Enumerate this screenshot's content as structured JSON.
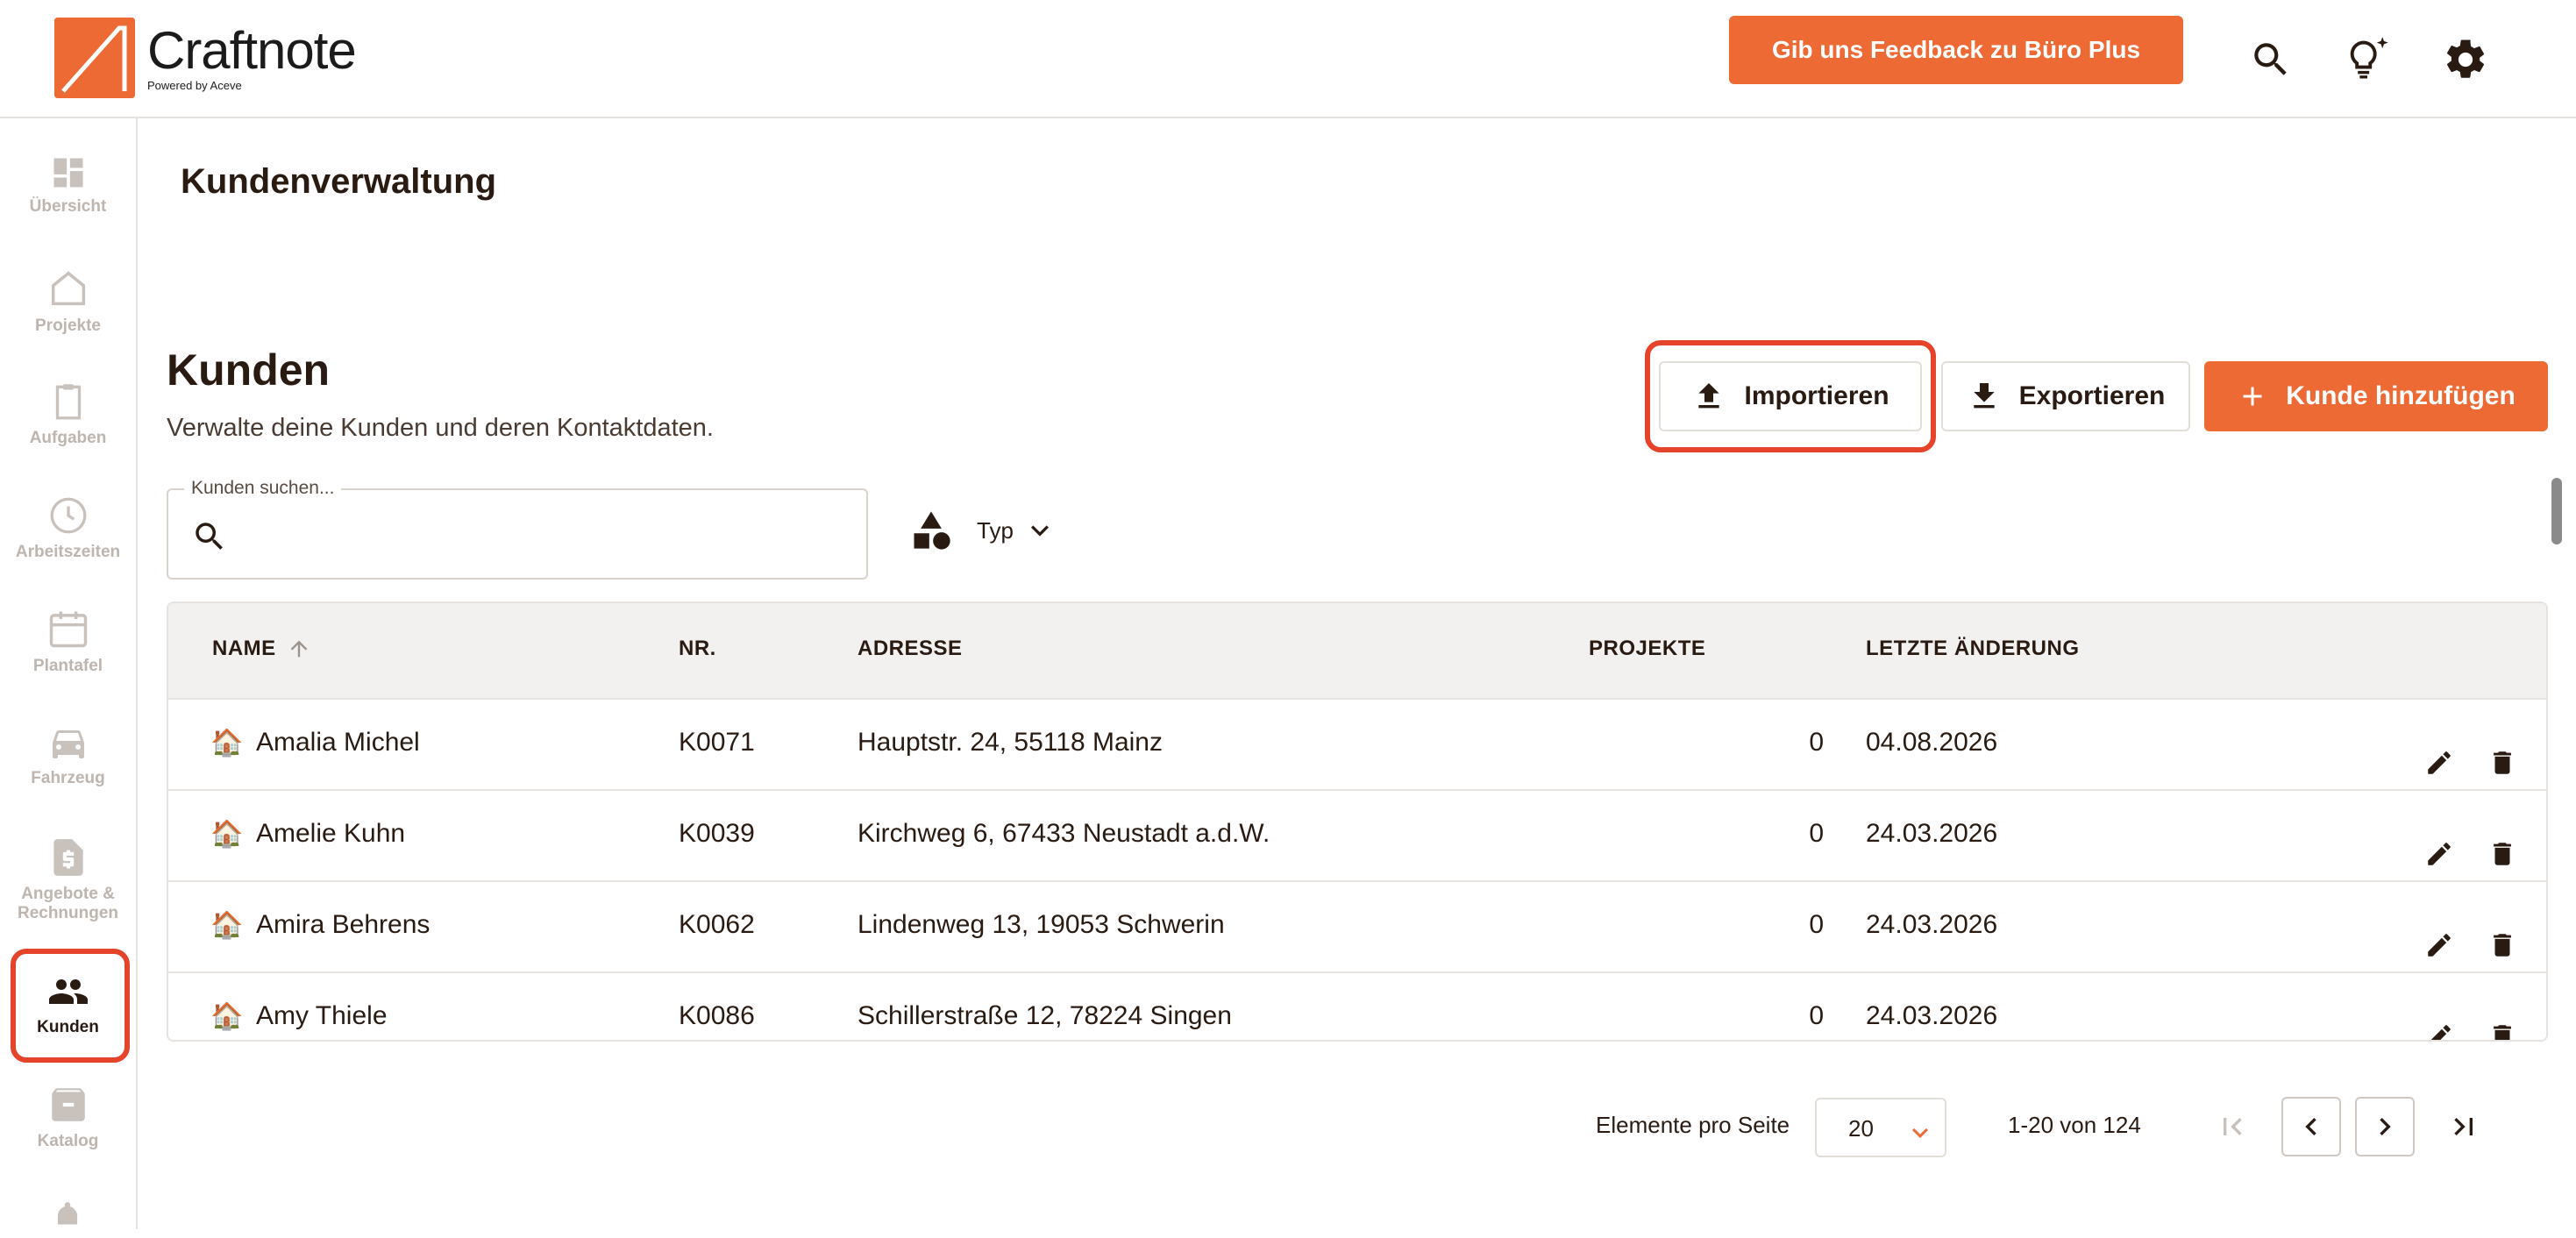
{
  "app": {
    "name": "Craftnote",
    "tagline": "Powered by Aceve",
    "feedback_label": "Gib uns Feedback zu Büro Plus",
    "accent_color": "#ee6a35",
    "highlight_color": "#e5432a"
  },
  "header_icons": [
    {
      "name": "search-icon"
    },
    {
      "name": "lightbulb-icon"
    },
    {
      "name": "gear-icon"
    }
  ],
  "sidebar": {
    "items": [
      {
        "label": "Übersicht",
        "icon": "dashboard-icon"
      },
      {
        "label": "Projekte",
        "icon": "home-icon"
      },
      {
        "label": "Aufgaben",
        "icon": "clipboard-icon"
      },
      {
        "label": "Arbeitszeiten",
        "icon": "clock-icon"
      },
      {
        "label": "Plantafel",
        "icon": "calendar-icon"
      },
      {
        "label": "Fahrzeug",
        "icon": "car-icon"
      },
      {
        "label": "Angebote & Rechnungen",
        "icon": "invoice-icon"
      },
      {
        "label": "Kunden",
        "icon": "people-icon",
        "active": true
      },
      {
        "label": "Katalog",
        "icon": "archive-icon"
      }
    ]
  },
  "page": {
    "title": "Kundenverwaltung",
    "section_title": "Kunden",
    "section_subtitle": "Verwalte deine Kunden und deren Kontaktdaten."
  },
  "toolbar": {
    "import_label": "Importieren",
    "export_label": "Exportieren",
    "add_label": "Kunde hinzufügen"
  },
  "search": {
    "label": "Kunden suchen...",
    "value": ""
  },
  "filter": {
    "type_label": "Typ"
  },
  "table": {
    "columns": [
      "NAME",
      "NR.",
      "ADRESSE",
      "PROJEKTE",
      "LETZTE ÄNDERUNG"
    ],
    "sort": {
      "column": "NAME",
      "direction": "ascending"
    },
    "rows": [
      {
        "name": "Amalia Michel",
        "nr": "K0071",
        "address": "Hauptstr. 24, 55118 Mainz",
        "projects": "0",
        "changed": "04.08.2026"
      },
      {
        "name": "Amelie Kuhn",
        "nr": "K0039",
        "address": "Kirchweg 6, 67433 Neustadt a.d.W.",
        "projects": "0",
        "changed": "24.03.2026"
      },
      {
        "name": "Amira Behrens",
        "nr": "K0062",
        "address": "Lindenweg 13, 19053 Schwerin",
        "projects": "0",
        "changed": "24.03.2026"
      },
      {
        "name": "Amy Thiele",
        "nr": "K0086",
        "address": "Schillerstraße 12, 78224 Singen",
        "projects": "0",
        "changed": "24.03.2026"
      }
    ]
  },
  "pagination": {
    "per_page_label": "Elemente pro Seite",
    "per_page_value": "20",
    "range_label": "1-20 von 124"
  }
}
